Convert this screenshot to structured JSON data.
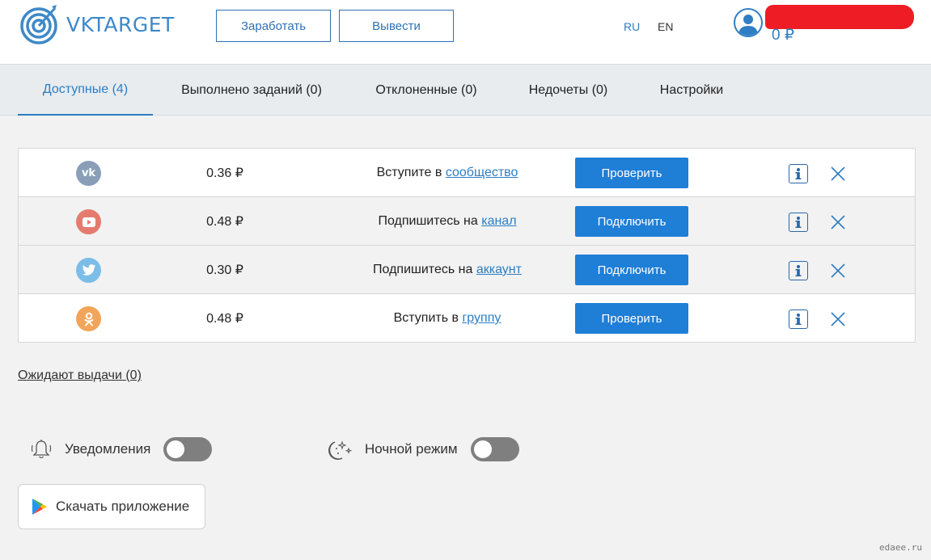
{
  "header": {
    "logo_text": "VKTARGET",
    "earn_label": "Заработать",
    "withdraw_label": "Вывести",
    "lang_ru": "RU",
    "lang_en": "EN",
    "balance": "0 ₽"
  },
  "tabs": [
    {
      "label": "Доступные (4)",
      "active": true
    },
    {
      "label": "Выполнено заданий (0)",
      "active": false
    },
    {
      "label": "Отклоненные (0)",
      "active": false
    },
    {
      "label": "Недочеты (0)",
      "active": false
    },
    {
      "label": "Настройки",
      "active": false
    }
  ],
  "tasks": [
    {
      "network": "vk-icon",
      "color": "#8a9fb7",
      "price": "0.36 ₽",
      "text": "Вступите в ",
      "link": "сообщество",
      "action": "Проверить"
    },
    {
      "network": "youtube-icon",
      "color": "#e57b6f",
      "price": "0.48 ₽",
      "text": "Подпишитесь на ",
      "link": "канал",
      "action": "Подключить"
    },
    {
      "network": "twitter-icon",
      "color": "#7cbde8",
      "price": "0.30 ₽",
      "text": "Подпишитесь на ",
      "link": "аккаунт",
      "action": "Подключить"
    },
    {
      "network": "odnoklassniki-icon",
      "color": "#f1a55a",
      "price": "0.48 ₽",
      "text": "Вступить в ",
      "link": "группу",
      "action": "Проверить"
    }
  ],
  "pending_label": "Ожидают выдачи (0)",
  "settings": {
    "notifications_label": "Уведомления",
    "notifications_on": false,
    "night_mode_label": "Ночной режим",
    "night_mode_on": false
  },
  "download_label": "Скачать приложение",
  "watermark": "edaee.ru",
  "colors": {
    "accent": "#1f7ed6",
    "link": "#2d7dc2",
    "toggle_off": "#7f7f7f"
  }
}
